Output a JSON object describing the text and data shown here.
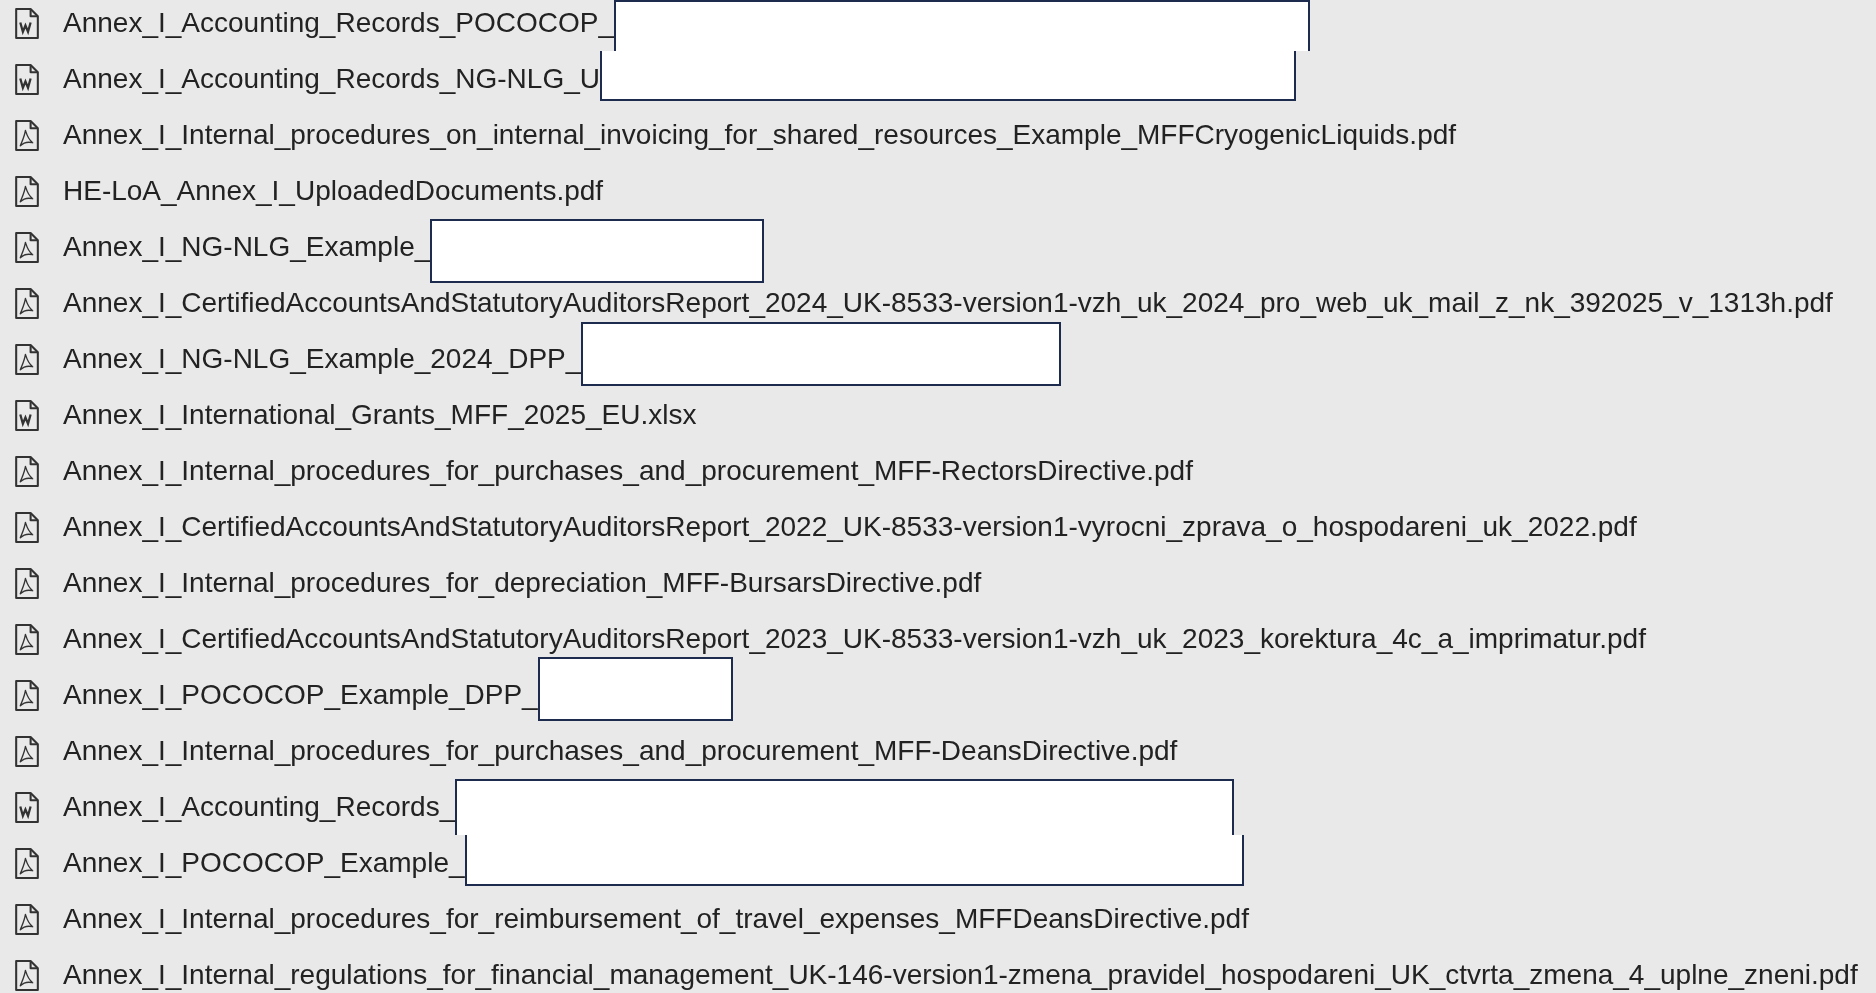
{
  "files": [
    {
      "kind": "word",
      "name": "Annex_I_Accounting_Records_POCOCOP_",
      "redacted": true
    },
    {
      "kind": "word",
      "name": "Annex_I_Accounting_Records_NG-NLG_U",
      "redacted": true
    },
    {
      "kind": "pdf",
      "name": "Annex_I_Internal_procedures_on_internal_invoicing_for_shared_resources_Example_MFFCryogenicLiquids.pdf",
      "redacted": false
    },
    {
      "kind": "pdf",
      "name": "HE-LoA_Annex_I_UploadedDocuments.pdf",
      "redacted": false
    },
    {
      "kind": "pdf",
      "name": "Annex_I_NG-NLG_Example_",
      "redacted": true
    },
    {
      "kind": "pdf",
      "name": "Annex_I_CertifiedAccountsAndStatutoryAuditorsReport_2024_UK-8533-version1-vzh_uk_2024_pro_web_uk_mail_z_nk_392025_v_1313h.pdf",
      "redacted": false
    },
    {
      "kind": "pdf",
      "name": "Annex_I_NG-NLG_Example_2024_DPP_",
      "redacted": true
    },
    {
      "kind": "word",
      "name": "Annex_I_International_Grants_MFF_2025_EU.xlsx",
      "redacted": false
    },
    {
      "kind": "pdf",
      "name": "Annex_I_Internal_procedures_for_purchases_and_procurement_MFF-RectorsDirective.pdf",
      "redacted": false
    },
    {
      "kind": "pdf",
      "name": "Annex_I_CertifiedAccountsAndStatutoryAuditorsReport_2022_UK-8533-version1-vyrocni_zprava_o_hospodareni_uk_2022.pdf",
      "redacted": false
    },
    {
      "kind": "pdf",
      "name": "Annex_I_Internal_procedures_for_depreciation_MFF-BursarsDirective.pdf",
      "redacted": false
    },
    {
      "kind": "pdf",
      "name": "Annex_I_CertifiedAccountsAndStatutoryAuditorsReport_2023_UK-8533-version1-vzh_uk_2023_korektura_4c_a_imprimatur.pdf",
      "redacted": false
    },
    {
      "kind": "pdf",
      "name": "Annex_I_POCOCOP_Example_DPP_",
      "redacted": true
    },
    {
      "kind": "pdf",
      "name": "Annex_I_Internal_procedures_for_purchases_and_procurement_MFF-DeansDirective.pdf",
      "redacted": false
    },
    {
      "kind": "word",
      "name": "Annex_I_Accounting_Records_",
      "redacted": true
    },
    {
      "kind": "pdf",
      "name": "Annex_I_POCOCOP_Example_",
      "redacted": true
    },
    {
      "kind": "pdf",
      "name": "Annex_I_Internal_procedures_for_reimbursement_of_travel_expenses_MFFDeansDirective.pdf",
      "redacted": false
    },
    {
      "kind": "pdf",
      "name": "Annex_I_Internal_regulations_for_financial_management_UK-146-version1-zmena_pravidel_hospodareni_UK_ctvrta_zmena_4_uplne_zneni.pdf",
      "redacted": false
    }
  ]
}
